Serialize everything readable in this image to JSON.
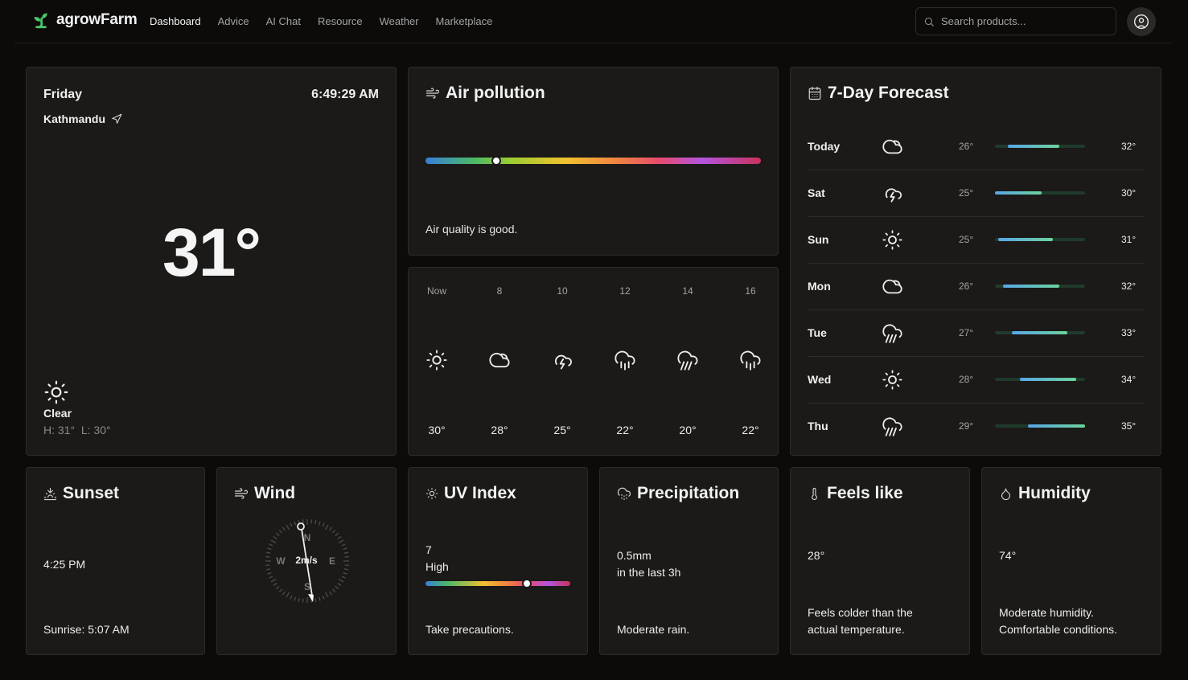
{
  "app": {
    "name": "agrowFarm",
    "brand_color": "#4cc26b"
  },
  "nav": [
    "Dashboard",
    "Advice",
    "AI Chat",
    "Resource",
    "Weather",
    "Marketplace"
  ],
  "search": {
    "placeholder": "Search products..."
  },
  "current": {
    "day": "Friday",
    "time": "6:49:29 AM",
    "city": "Kathmandu",
    "temp": "31°",
    "condition": "Clear",
    "condition_icon": "sun-icon",
    "high": "H: 31°",
    "low": "L: 30°"
  },
  "air": {
    "title": "Air pollution",
    "message": "Air quality is good.",
    "level": 0.21
  },
  "hourly": [
    {
      "label": "Now",
      "icon": "sun",
      "temp": "30°"
    },
    {
      "label": "8",
      "icon": "cloud",
      "temp": "28°"
    },
    {
      "label": "10",
      "icon": "storm",
      "temp": "25°"
    },
    {
      "label": "12",
      "icon": "rain",
      "temp": "22°"
    },
    {
      "label": "14",
      "icon": "rain-heavy",
      "temp": "20°"
    },
    {
      "label": "16",
      "icon": "rain",
      "temp": "22°"
    }
  ],
  "forecast": {
    "title": "7-Day Forecast",
    "days": [
      {
        "day": "Today",
        "icon": "cloud",
        "low": "26°",
        "high": "32°",
        "range": [
          0.14,
          0.71
        ]
      },
      {
        "day": "Sat",
        "icon": "storm",
        "low": "25°",
        "high": "30°",
        "range": [
          0.0,
          0.52
        ]
      },
      {
        "day": "Sun",
        "icon": "sun",
        "low": "25°",
        "high": "31°",
        "range": [
          0.04,
          0.64
        ]
      },
      {
        "day": "Mon",
        "icon": "cloud",
        "low": "26°",
        "high": "32°",
        "range": [
          0.09,
          0.71
        ]
      },
      {
        "day": "Tue",
        "icon": "rain-heavy",
        "low": "27°",
        "high": "33°",
        "range": [
          0.19,
          0.8
        ]
      },
      {
        "day": "Wed",
        "icon": "sun",
        "low": "28°",
        "high": "34°",
        "range": [
          0.28,
          0.9
        ]
      },
      {
        "day": "Thu",
        "icon": "rain-heavy",
        "low": "29°",
        "high": "35°",
        "range": [
          0.37,
          1.0
        ]
      }
    ]
  },
  "sunset": {
    "title": "Sunset",
    "time": "4:25 PM",
    "sunrise": "Sunrise: 5:07 AM"
  },
  "wind": {
    "title": "Wind",
    "speed": "2m/s",
    "n": "N",
    "e": "E",
    "s": "S",
    "w": "W"
  },
  "uv": {
    "title": "UV Index",
    "value": "7",
    "level": "High",
    "advice": "Take precautions.",
    "position": 0.7
  },
  "precipitation": {
    "title": "Precipitation",
    "amount": "0.5mm",
    "period": "in the last 3h",
    "desc": "Moderate rain."
  },
  "feels_like": {
    "title": "Feels like",
    "value": "28°",
    "desc1": "Feels colder than the",
    "desc2": "actual temperature."
  },
  "humidity": {
    "title": "Humidity",
    "value": "74°",
    "desc1": "Moderate humidity.",
    "desc2": "Comfortable conditions."
  }
}
